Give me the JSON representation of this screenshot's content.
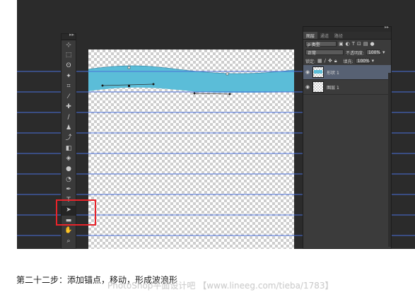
{
  "toolbox": {
    "collapse_glyph": "▸▸",
    "tools": [
      {
        "name": "move-tool-icon",
        "glyph": "⊹"
      },
      {
        "name": "marquee-tool-icon",
        "glyph": "⬚"
      },
      {
        "name": "lasso-tool-icon",
        "glyph": "ʘ"
      },
      {
        "name": "magic-wand-tool-icon",
        "glyph": "✦"
      },
      {
        "name": "crop-tool-icon",
        "glyph": "⌗"
      },
      {
        "name": "eyedropper-tool-icon",
        "glyph": "⁄"
      },
      {
        "name": "healing-brush-tool-icon",
        "glyph": "✚"
      },
      {
        "name": "brush-tool-icon",
        "glyph": "∕"
      },
      {
        "name": "clone-stamp-tool-icon",
        "glyph": "♟"
      },
      {
        "name": "history-brush-tool-icon",
        "glyph": "⤴"
      },
      {
        "name": "eraser-tool-icon",
        "glyph": "◧"
      },
      {
        "name": "paint-bucket-tool-icon",
        "glyph": "◈"
      },
      {
        "name": "blur-tool-icon",
        "glyph": "●"
      },
      {
        "name": "dodge-tool-icon",
        "glyph": "◔"
      },
      {
        "name": "pen-tool-icon",
        "glyph": "✒"
      },
      {
        "name": "type-tool-icon",
        "glyph": "T"
      },
      {
        "name": "path-selection-tool-icon",
        "glyph": "➤"
      },
      {
        "name": "rectangle-tool-icon",
        "glyph": "▬"
      },
      {
        "name": "hand-tool-icon",
        "glyph": "✋"
      },
      {
        "name": "zoom-tool-icon",
        "glyph": "⌕"
      }
    ]
  },
  "layers_panel": {
    "collapse_glyph": "▸▸",
    "tabs": [
      "图层",
      "通道",
      "路径"
    ],
    "filter_kind": "ρ 类型",
    "blend_mode": "正常",
    "opacity_label": "不透明度:",
    "opacity_value": "100%",
    "lock_label": "锁定:",
    "fill_label": "填充:",
    "fill_value": "100%",
    "layers": [
      {
        "name": "形状 1",
        "selected": true
      },
      {
        "name": "图层 1",
        "selected": false
      }
    ]
  },
  "colors": {
    "wave_fill": "#5bbdd8",
    "guide_line": "#4a6fd8",
    "highlight_box": "#e8232a"
  },
  "caption": "第二十二步：添加锚点，移动，形成波浪形",
  "watermark": "PhotoShop平面设计吧 【www.lineeg.com/tieba/1783】"
}
